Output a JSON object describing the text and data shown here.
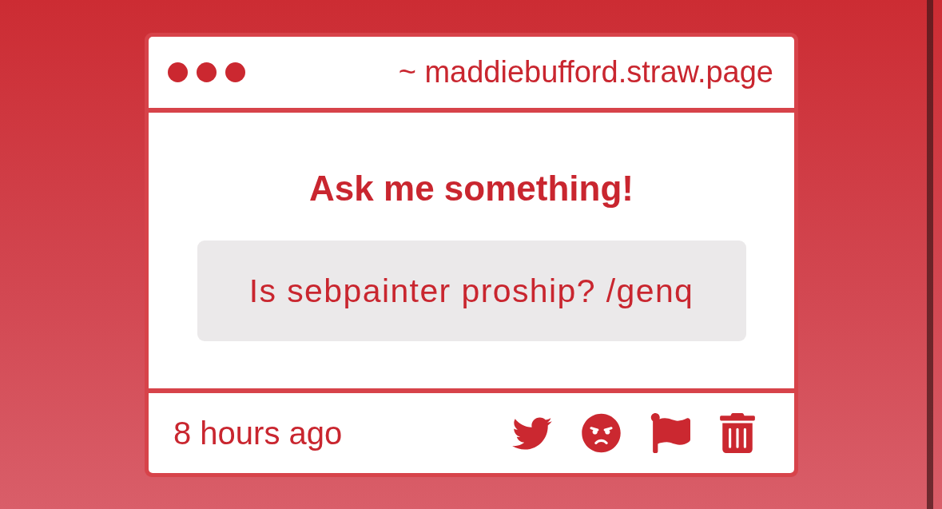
{
  "header": {
    "url": "~ maddiebufford.straw.page"
  },
  "card": {
    "title": "Ask me something!",
    "question": "Is sebpainter proship? /genq"
  },
  "footer": {
    "time": "8 hours ago",
    "actions": [
      {
        "kind": "twitter"
      },
      {
        "kind": "angry"
      },
      {
        "kind": "flag"
      },
      {
        "kind": "delete"
      }
    ]
  }
}
